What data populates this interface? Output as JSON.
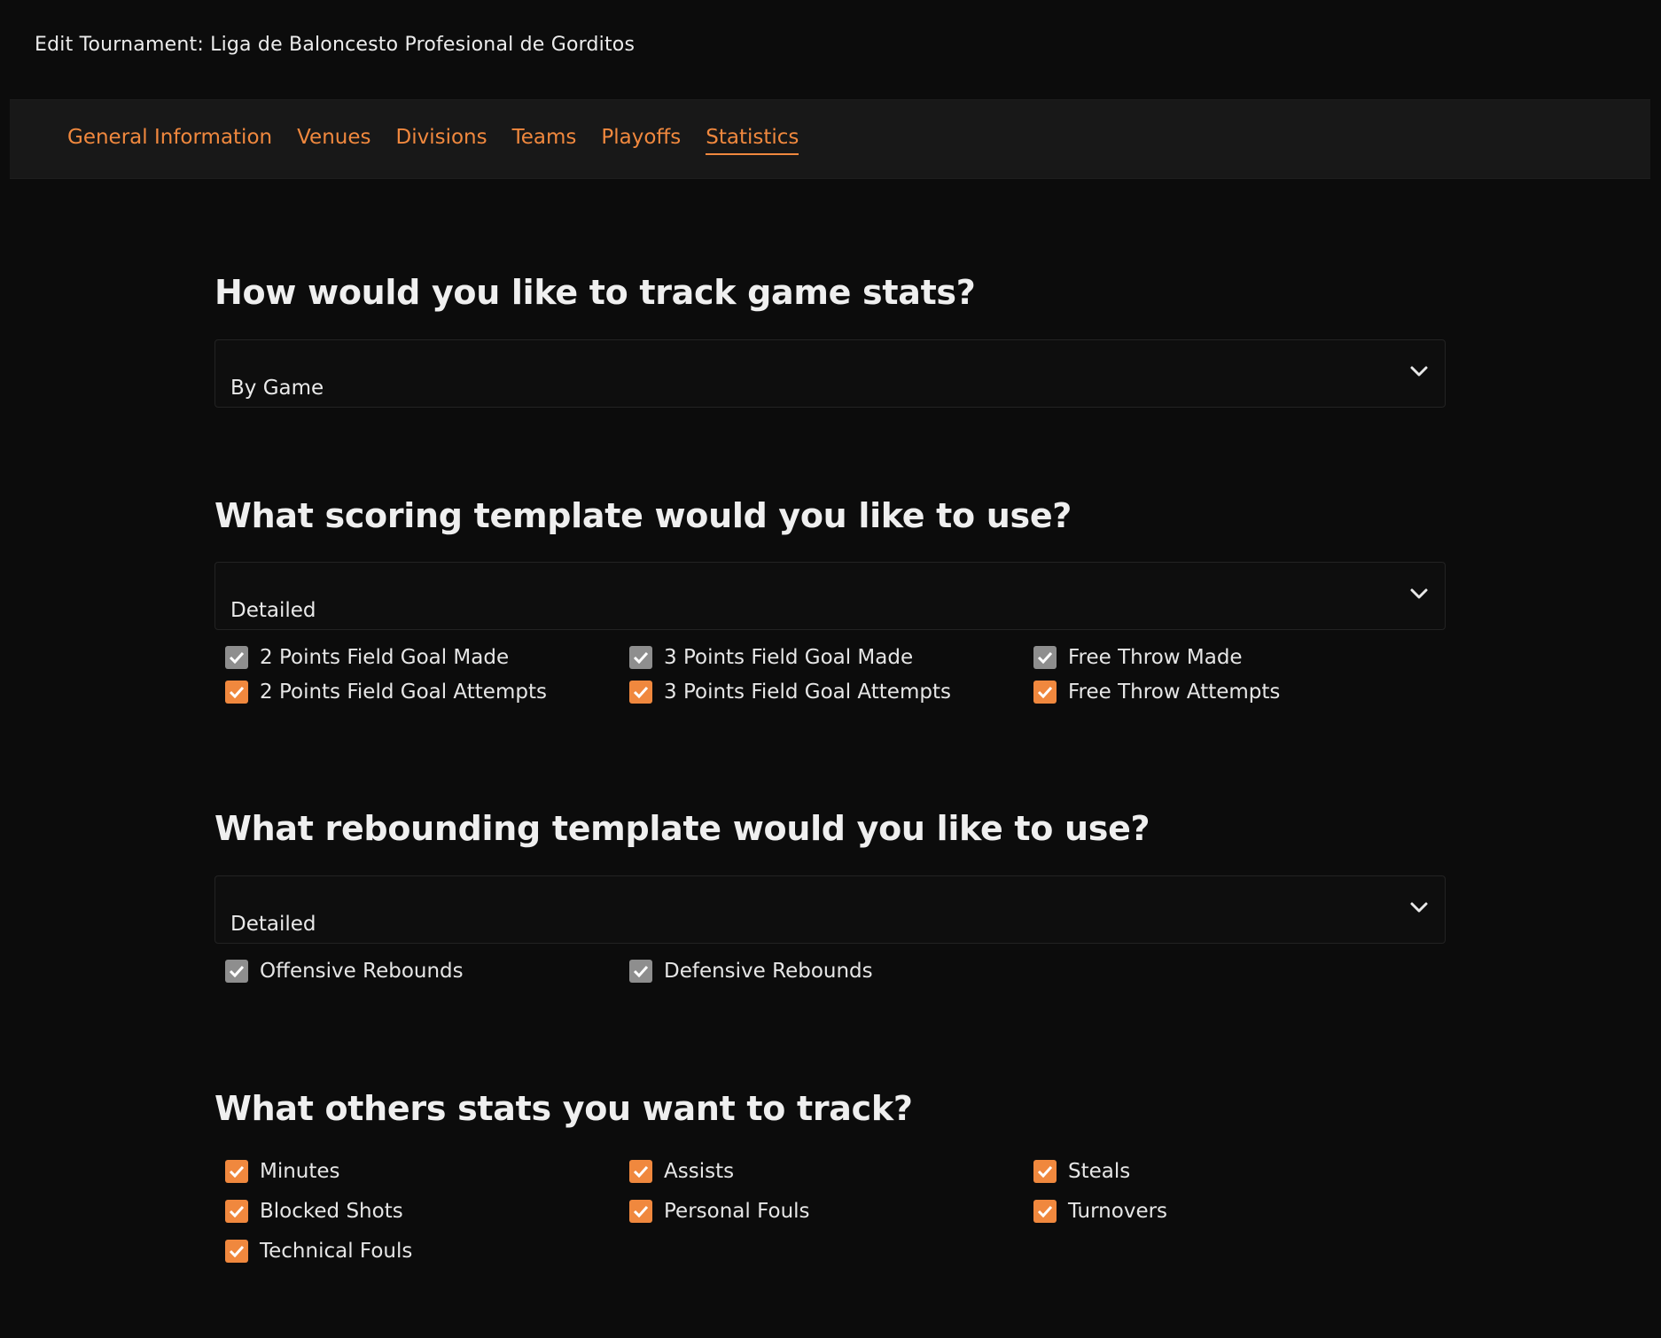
{
  "header": {
    "title": "Edit Tournament: Liga de Baloncesto Profesional de Gorditos"
  },
  "tabs": [
    {
      "label": "General Information"
    },
    {
      "label": "Venues"
    },
    {
      "label": "Divisions"
    },
    {
      "label": "Teams"
    },
    {
      "label": "Playoffs"
    },
    {
      "label": "Statistics",
      "active": true
    }
  ],
  "colors": {
    "accent": "#f0883e",
    "background": "#0c0c0c",
    "tabbar": "#181818",
    "disabled_check": "#8e8e8e"
  },
  "game_stats": {
    "question": "How would you like to track game stats?",
    "selected": "By Game"
  },
  "scoring": {
    "question": "What scoring template would you like to use?",
    "selected": "Detailed",
    "options": [
      {
        "label": "2 Points Field Goal Made",
        "checked": true,
        "disabled": true
      },
      {
        "label": "3 Points Field Goal Made",
        "checked": true,
        "disabled": true
      },
      {
        "label": "Free Throw Made",
        "checked": true,
        "disabled": true
      },
      {
        "label": "2 Points Field Goal Attempts",
        "checked": true,
        "disabled": false
      },
      {
        "label": "3 Points Field Goal Attempts",
        "checked": true,
        "disabled": false
      },
      {
        "label": "Free Throw Attempts",
        "checked": true,
        "disabled": false
      }
    ]
  },
  "rebounding": {
    "question": "What rebounding template would you like to use?",
    "selected": "Detailed",
    "options": [
      {
        "label": "Offensive Rebounds",
        "checked": true,
        "disabled": true
      },
      {
        "label": "Defensive Rebounds",
        "checked": true,
        "disabled": true
      }
    ]
  },
  "others": {
    "question": "What others stats you want to track?",
    "options": [
      {
        "label": "Minutes",
        "checked": true
      },
      {
        "label": "Assists",
        "checked": true
      },
      {
        "label": "Steals",
        "checked": true
      },
      {
        "label": "Blocked Shots",
        "checked": true
      },
      {
        "label": "Personal Fouls",
        "checked": true
      },
      {
        "label": "Turnovers",
        "checked": true
      },
      {
        "label": "Technical Fouls",
        "checked": true
      }
    ]
  }
}
